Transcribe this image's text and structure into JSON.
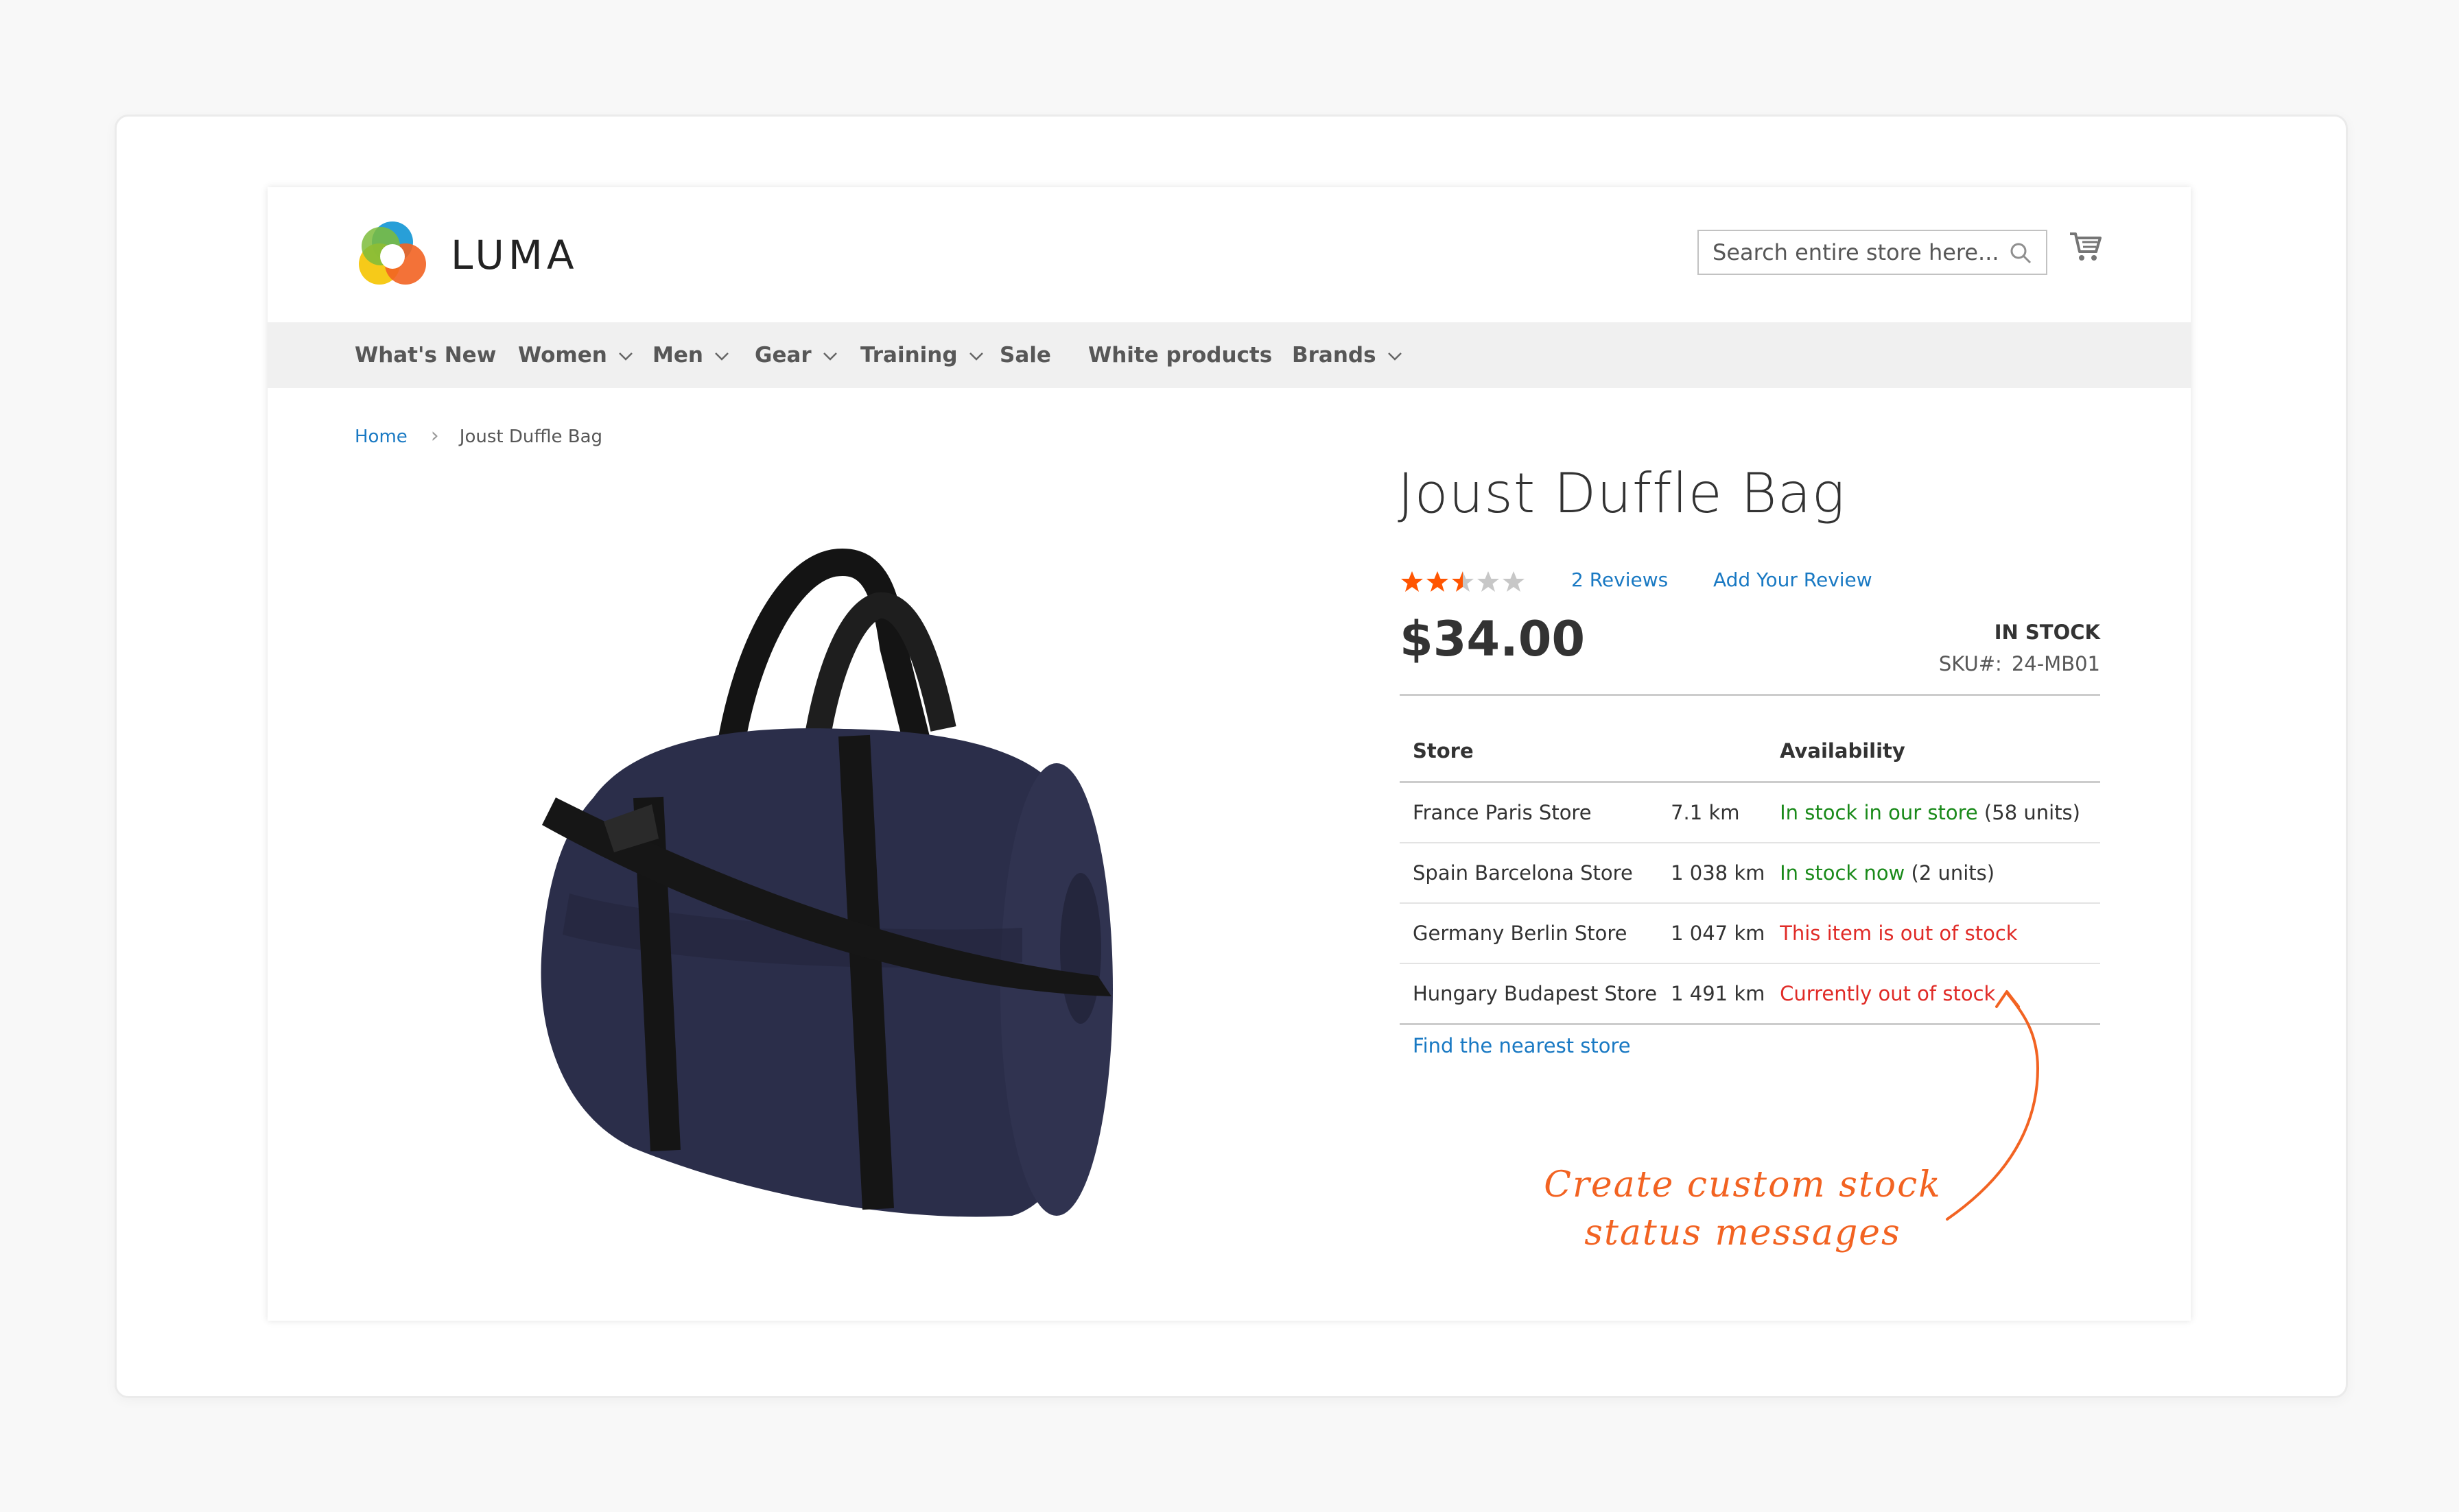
{
  "header": {
    "logo_text": "LUMA",
    "search_placeholder": "Search entire store here..."
  },
  "nav": {
    "items": [
      {
        "label": "What's New",
        "has_dropdown": false
      },
      {
        "label": "Women",
        "has_dropdown": true
      },
      {
        "label": "Men",
        "has_dropdown": true
      },
      {
        "label": "Gear",
        "has_dropdown": true
      },
      {
        "label": "Training",
        "has_dropdown": true
      },
      {
        "label": "Sale",
        "has_dropdown": false
      },
      {
        "label": "White products",
        "has_dropdown": false
      },
      {
        "label": "Brands",
        "has_dropdown": true
      }
    ]
  },
  "breadcrumb": {
    "home": "Home",
    "separator": "›",
    "current": "Joust Duffle Bag"
  },
  "product": {
    "title": "Joust Duffle Bag",
    "rating_stars": 2.5,
    "rating_max": 5,
    "reviews_label": "2  Reviews",
    "add_review_label": "Add Your Review",
    "price": "$34.00",
    "stock_status": "IN STOCK",
    "sku_label": "SKU#:",
    "sku_value": "24-MB01"
  },
  "stores_table": {
    "headers": {
      "store": "Store",
      "availability": "Availability"
    },
    "rows": [
      {
        "store": "France Paris Store",
        "distance": "7.1 km",
        "status": "In stock in our store",
        "units": " (58 units)",
        "status_type": "in"
      },
      {
        "store": "Spain Barcelona Store",
        "distance": "1 038  km",
        "status": "In stock now",
        "units": " (2 units)",
        "status_type": "in"
      },
      {
        "store": "Germany Berlin Store",
        "distance": "1 047  km",
        "status": "This item is out of stock",
        "units": "",
        "status_type": "out"
      },
      {
        "store": "Hungary Budapest Store",
        "distance": "1 491 km",
        "status": "Currently out of stock",
        "units": "",
        "status_type": "out"
      }
    ],
    "find_store_label": "Find the nearest store"
  },
  "annotation": {
    "line1": "Create custom stock",
    "line2": "status messages"
  },
  "colors": {
    "link": "#1979c3",
    "in_stock": "#1a8a1a",
    "out_of_stock": "#e02b27",
    "annotation": "#f26322",
    "star": "#ff5501"
  }
}
